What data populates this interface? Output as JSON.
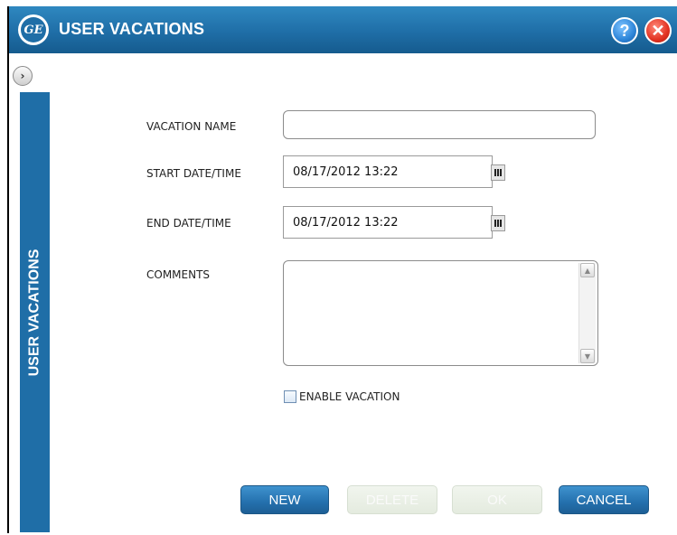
{
  "window": {
    "title": "USER VACATIONS",
    "logo_text": "GE",
    "help_label": "?",
    "close_label": "✕",
    "expand_label": "›"
  },
  "sidebar": {
    "label": "USER VACATIONS"
  },
  "form": {
    "vacation_name": {
      "label": "VACATION NAME",
      "value": ""
    },
    "start_datetime": {
      "label": "START DATE/TIME",
      "value": "08/17/2012 13:22"
    },
    "end_datetime": {
      "label": "END DATE/TIME",
      "value": "08/17/2012 13:22"
    },
    "comments": {
      "label": "COMMENTS",
      "value": ""
    },
    "enable_vacation": {
      "label": "ENABLE VACATION",
      "checked": false
    }
  },
  "buttons": {
    "new": "NEW",
    "delete": "DELETE",
    "ok": "OK",
    "cancel": "CANCEL"
  },
  "colors": {
    "accent": "#1f6ea7",
    "disabled_button": "#e7eee2"
  }
}
